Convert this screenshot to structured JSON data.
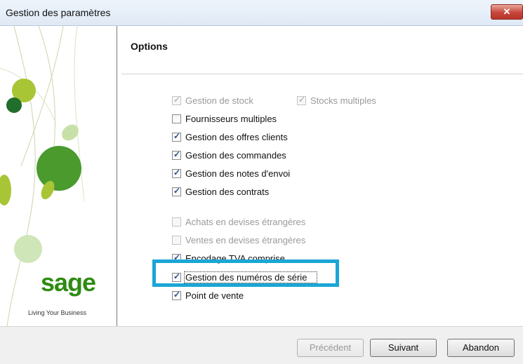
{
  "window": {
    "title": "Gestion des paramètres",
    "close_glyph": "✕"
  },
  "sidebar": {
    "logo": "sage",
    "tagline": "Living Your Business",
    "brand_color": "#2e8b12"
  },
  "options": {
    "title": "Options",
    "items": [
      {
        "label": "Gestion de stock",
        "checked": true,
        "disabled": true
      },
      {
        "label": "Stocks multiples",
        "checked": true,
        "disabled": true
      },
      {
        "label": "Fournisseurs multiples",
        "checked": false,
        "disabled": false
      },
      {
        "label": "Gestion des offres clients",
        "checked": true,
        "disabled": false
      },
      {
        "label": "Gestion des commandes",
        "checked": true,
        "disabled": false
      },
      {
        "label": "Gestion des notes d'envoi",
        "checked": true,
        "disabled": false
      },
      {
        "label": "Gestion des contrats",
        "checked": true,
        "disabled": false
      },
      {
        "label": "Achats en devises étrangères",
        "checked": false,
        "disabled": true
      },
      {
        "label": "Ventes en devises étrangères",
        "checked": false,
        "disabled": true
      },
      {
        "label": "Encodage TVA comprise",
        "checked": true,
        "disabled": false
      },
      {
        "label": "Gestion des numéros de série",
        "checked": true,
        "disabled": false
      },
      {
        "label": "Point de vente",
        "checked": true,
        "disabled": false
      }
    ],
    "highlight_color": "#1aa6d6"
  },
  "footer": {
    "prev_label": "Précédent",
    "next_label": "Suivant",
    "cancel_label": "Abandon"
  }
}
